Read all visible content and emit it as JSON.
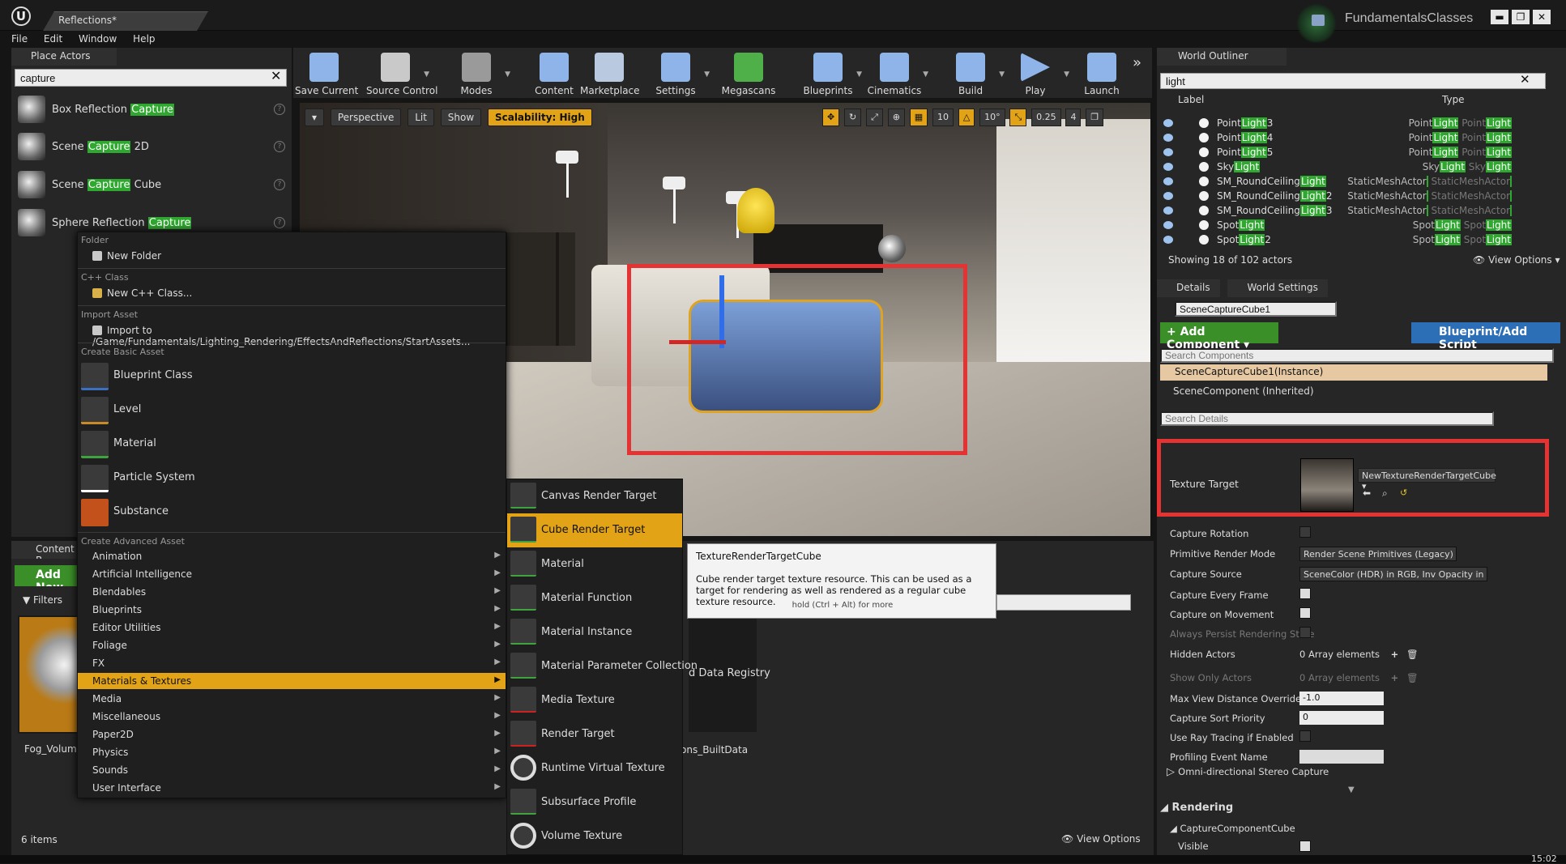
{
  "window": {
    "doc_tab": "Reflections*",
    "project": "FundamentalsClasses",
    "menu": [
      "File",
      "Edit",
      "Window",
      "Help"
    ]
  },
  "place_actors": {
    "tab": "Place Actors",
    "search": "capture",
    "items": [
      {
        "pre": "Box Reflection ",
        "hl": "Capture",
        "post": ""
      },
      {
        "pre": "Scene ",
        "hl": "Capture",
        "post": " 2D"
      },
      {
        "pre": "Scene ",
        "hl": "Capture",
        "post": " Cube"
      },
      {
        "pre": "Sphere Reflection ",
        "hl": "Capture",
        "post": ""
      }
    ]
  },
  "toolbar": [
    "Save Current",
    "Source Control",
    "Modes",
    "Content",
    "Marketplace",
    "Settings",
    "Megascans",
    "Blueprints",
    "Cinematics",
    "Build",
    "Play",
    "Launch"
  ],
  "viewport": {
    "perspective": "Perspective",
    "lit": "Lit",
    "show": "Show",
    "scalability": "Scalability: High",
    "grid": "10",
    "rot": "10°",
    "scale": "0.25",
    "cam": "4"
  },
  "context_menu": {
    "folder_header": "Folder",
    "new_folder": "New Folder",
    "cpp_header": "C++ Class",
    "new_cpp": "New C++ Class...",
    "import_header": "Import Asset",
    "import_to": "Import to /Game/Fundamentals/Lighting_Rendering/EffectsAndReflections/StartAssets...",
    "basic_header": "Create Basic Asset",
    "basic": [
      "Blueprint Class",
      "Level",
      "Material",
      "Particle System",
      "Substance"
    ],
    "advanced_header": "Create Advanced Asset",
    "advanced": [
      "Animation",
      "Artificial Intelligence",
      "Blendables",
      "Blueprints",
      "Editor Utilities",
      "Foliage",
      "FX",
      "Materials & Textures",
      "Media",
      "Miscellaneous",
      "Paper2D",
      "Physics",
      "Sounds",
      "User Interface"
    ]
  },
  "submenu": [
    "Canvas Render Target",
    "Cube Render Target",
    "Material",
    "Material Function",
    "Material Instance",
    "Material Parameter Collection",
    "Media Texture",
    "Render Target",
    "Runtime Virtual Texture",
    "Subsurface Profile",
    "Volume Texture"
  ],
  "tooltip": {
    "title": "TextureRenderTargetCube",
    "body": "Cube render target texture resource. This can be used as a target for rendering as well as rendered as a regular cube texture resource.",
    "hint": "hold (Ctrl + Alt) for more"
  },
  "content_browser": {
    "tab": "Content B",
    "add_new": "Add New",
    "filters": "Filters",
    "asset_label": "Fog_Volume",
    "registry_label": "d Data Registry",
    "builtdata_label": "ons_BuiltData",
    "items_count": "6 items",
    "view_options": "View Options"
  },
  "outliner": {
    "tab": "World Outliner",
    "search": "light",
    "col_label": "Label",
    "col_type": "Type",
    "rows": [
      {
        "pre": "Point",
        "hl": "Light",
        "post": "3",
        "tpre": "Point",
        "thl": "Light",
        "tpre2": "Point",
        "thl2": "Light"
      },
      {
        "pre": "Point",
        "hl": "Light",
        "post": "4",
        "tpre": "Point",
        "thl": "Light",
        "tpre2": "Point",
        "thl2": "Light"
      },
      {
        "pre": "Point",
        "hl": "Light",
        "post": "5",
        "tpre": "Point",
        "thl": "Light",
        "tpre2": "Point",
        "thl2": "Light"
      },
      {
        "pre": "Sky",
        "hl": "Light",
        "post": "",
        "tpre": "Sky",
        "thl": "Light",
        "tpre2": "Sky",
        "thl2": "Light"
      },
      {
        "pre": "SM_RoundCeiling",
        "hl": "Light",
        "post": "",
        "tpre": "StaticMeshActor",
        "thl": "",
        "tpre2": "StaticMeshActor",
        "thl2": ""
      },
      {
        "pre": "SM_RoundCeiling",
        "hl": "Light",
        "post": "2",
        "tpre": "StaticMeshActor",
        "thl": "",
        "tpre2": "StaticMeshActor",
        "thl2": ""
      },
      {
        "pre": "SM_RoundCeiling",
        "hl": "Light",
        "post": "3",
        "tpre": "StaticMeshActor",
        "thl": "",
        "tpre2": "StaticMeshActor",
        "thl2": ""
      },
      {
        "pre": "Spot",
        "hl": "Light",
        "post": "",
        "tpre": "Spot",
        "thl": "Light",
        "tpre2": "Spot",
        "thl2": "Light"
      },
      {
        "pre": "Spot",
        "hl": "Light",
        "post": "2",
        "tpre": "Spot",
        "thl": "Light",
        "tpre2": "Spot",
        "thl2": "Light"
      }
    ],
    "count": "Showing 18 of 102 actors",
    "view_options": "View Options"
  },
  "details": {
    "tab": "Details",
    "world_settings_tab": "World Settings",
    "actor_name": "SceneCaptureCube1",
    "add_component": "Add Component",
    "blueprint_script": "Blueprint/Add Script",
    "search_components": "Search Components",
    "component_selected": "SceneCaptureCube1(Instance)",
    "component_inherited": "SceneComponent (Inherited)",
    "search_details": "Search Details",
    "texture_target_label": "Texture Target",
    "texture_target_value": "NewTextureRenderTargetCube",
    "props": [
      {
        "label": "Capture Rotation",
        "kind": "check",
        "checked": false
      },
      {
        "label": "Primitive Render Mode",
        "kind": "drop",
        "value": "Render Scene Primitives (Legacy)"
      },
      {
        "label": "Capture Source",
        "kind": "drop",
        "value": "SceneColor (HDR) in RGB, Inv Opacity in A"
      },
      {
        "label": "Capture Every Frame",
        "kind": "check",
        "checked": true
      },
      {
        "label": "Capture on Movement",
        "kind": "check",
        "checked": true
      },
      {
        "label": "Always Persist Rendering State",
        "kind": "check",
        "checked": false,
        "dim": true
      },
      {
        "label": "Hidden Actors",
        "kind": "array",
        "value": "0 Array elements"
      },
      {
        "label": "Show Only Actors",
        "kind": "array",
        "value": "0 Array elements",
        "dim": true
      },
      {
        "label": "Max View Distance Override",
        "kind": "num",
        "value": "-1.0"
      },
      {
        "label": "Capture Sort Priority",
        "kind": "num",
        "value": "0"
      },
      {
        "label": "Use Ray Tracing if Enabled",
        "kind": "check",
        "checked": false
      },
      {
        "label": "Profiling Event Name",
        "kind": "text",
        "value": ""
      }
    ],
    "omni_section": "Omni-directional Stereo Capture",
    "rendering_section": "Rendering",
    "capture_component_cube": "CaptureComponentCube",
    "visible_label": "Visible"
  },
  "clock": "15:02"
}
